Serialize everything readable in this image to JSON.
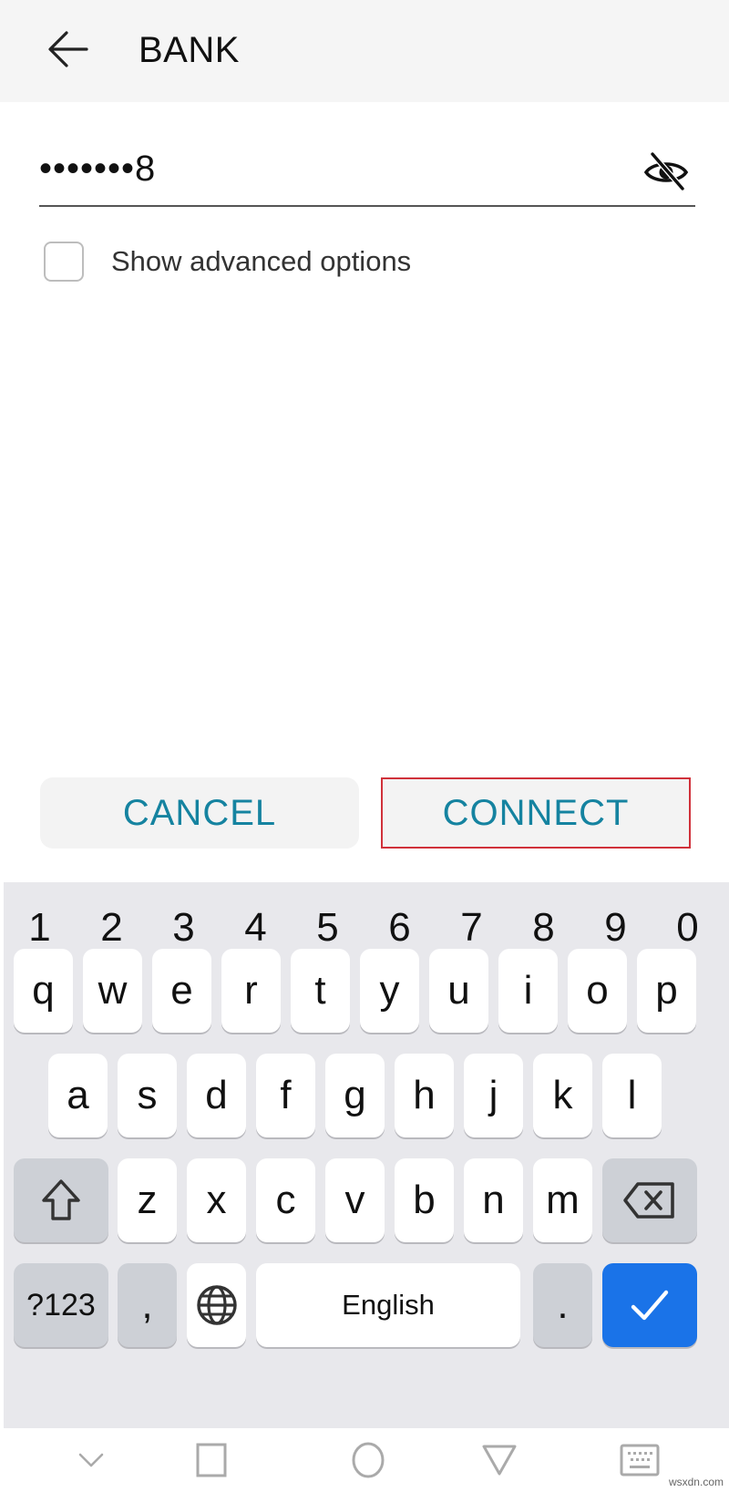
{
  "header": {
    "back_icon": "arrow-left-icon",
    "title": "BANK"
  },
  "password_field": {
    "masked_value": "•••••••8",
    "visibility_icon": "eye-off-icon"
  },
  "advanced_options": {
    "label": "Show advanced options",
    "checked": false
  },
  "actions": {
    "cancel_label": "CANCEL",
    "connect_label": "CONNECT",
    "accent_color": "#1583a0",
    "highlight_color": "#d0313a"
  },
  "keyboard": {
    "number_row": [
      "1",
      "2",
      "3",
      "4",
      "5",
      "6",
      "7",
      "8",
      "9",
      "0"
    ],
    "row1": [
      "q",
      "w",
      "e",
      "r",
      "t",
      "y",
      "u",
      "i",
      "o",
      "p"
    ],
    "row2": [
      "a",
      "s",
      "d",
      "f",
      "g",
      "h",
      "j",
      "k",
      "l"
    ],
    "row3": [
      "z",
      "x",
      "c",
      "v",
      "b",
      "n",
      "m"
    ],
    "shift_icon": "shift-icon",
    "backspace_icon": "backspace-icon",
    "symbols_label": "?123",
    "comma_label": ",",
    "globe_icon": "globe-icon",
    "space_label": "English",
    "period_label": ".",
    "enter_icon": "checkmark-icon",
    "enter_color": "#1a73e8"
  },
  "navbar": {
    "items": [
      "collapse-keyboard-icon",
      "recents-square-icon",
      "home-circle-icon",
      "back-triangle-icon",
      "keyboard-switch-icon"
    ]
  },
  "watermark": "wsxdn.com"
}
